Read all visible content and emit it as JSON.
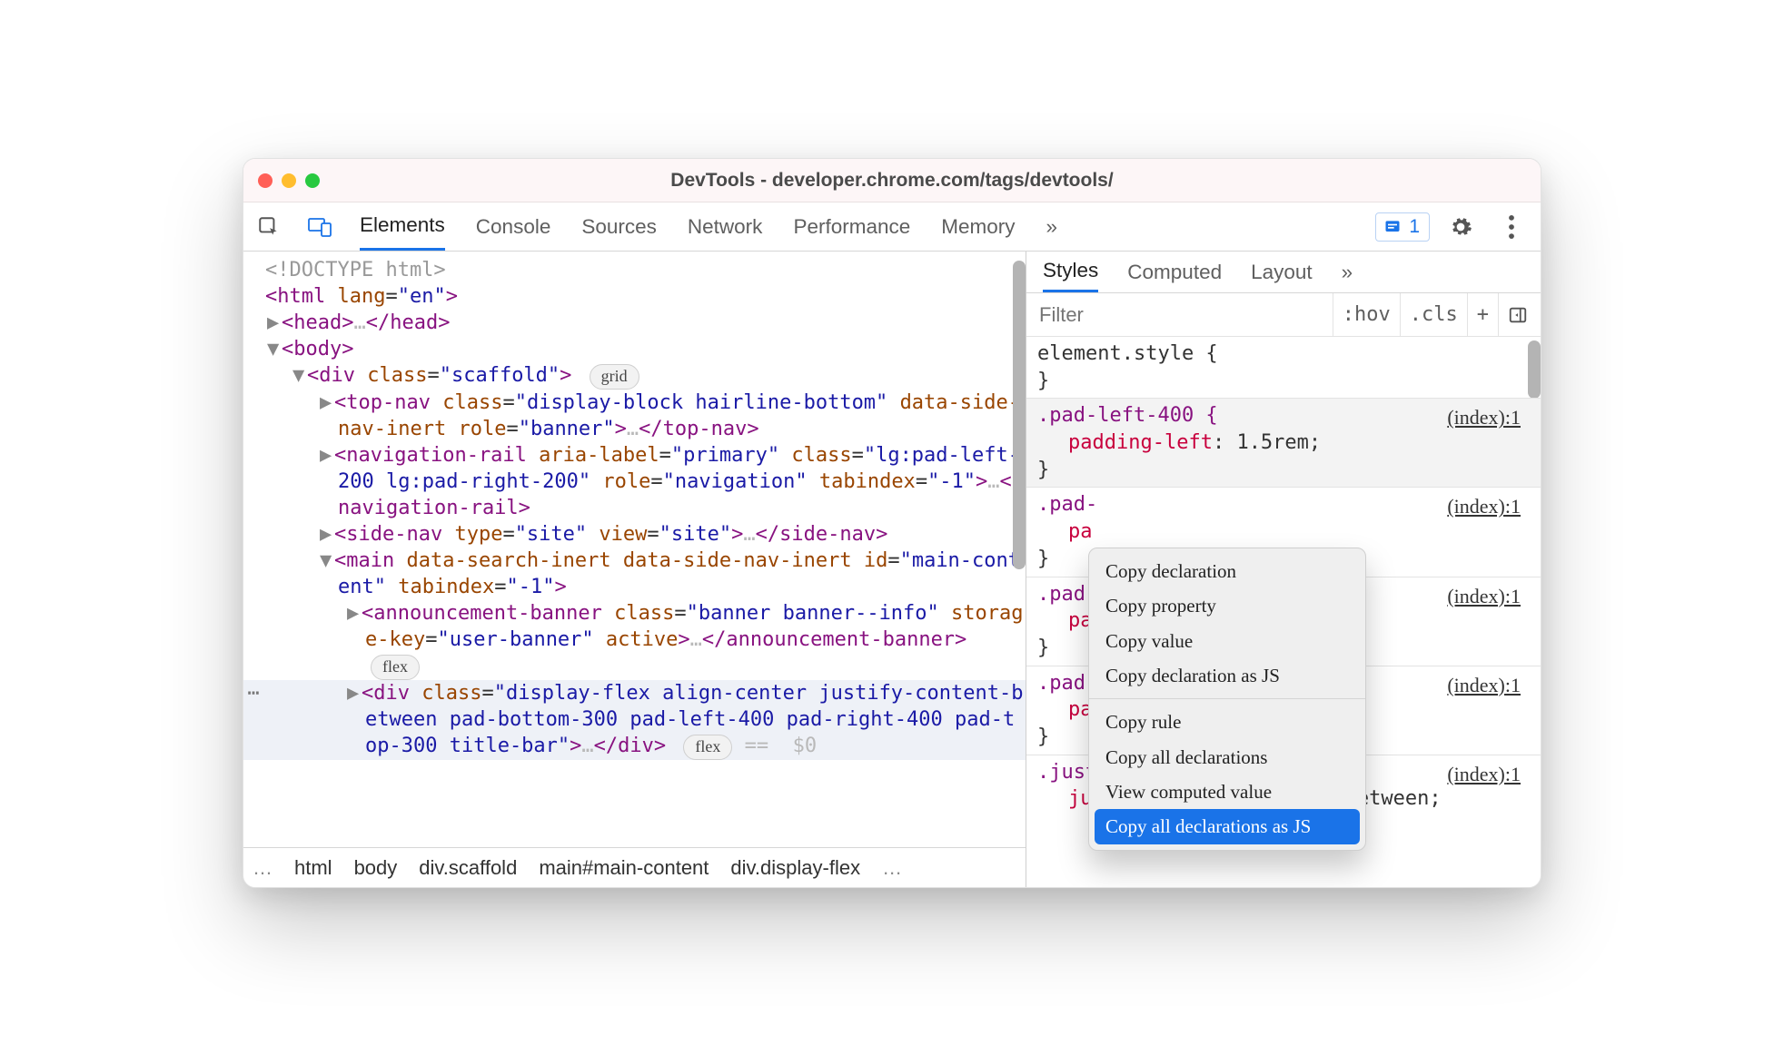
{
  "window": {
    "title": "DevTools - developer.chrome.com/tags/devtools/"
  },
  "toolbar": {
    "tabs": [
      "Elements",
      "Console",
      "Sources",
      "Network",
      "Performance",
      "Memory"
    ],
    "overflow": "»",
    "issues_count": "1"
  },
  "dom": {
    "l0": "<!DOCTYPE html>",
    "badge_grid": "grid",
    "badge_flex": "flex",
    "eq0": "==  $0"
  },
  "crumbs": {
    "ell": "…",
    "c0": "html",
    "c1": "body",
    "c2": "div.scaffold",
    "c3": "main#main-content",
    "c4": "div.display-flex",
    "ell2": "…"
  },
  "subtabs": {
    "t0": "Styles",
    "t1": "Computed",
    "t2": "Layout",
    "more": "»"
  },
  "filter": {
    "ph": "Filter",
    "hov": ":hov",
    "cls": ".cls",
    "plus": "+"
  },
  "styles": {
    "block0": {
      "sel": "element.style {",
      "close": "}"
    },
    "block1": {
      "sel": ".pad-left-400 {",
      "src": "(index):1",
      "decl_p": "padding-left",
      "decl_v": ": 1.5rem;",
      "close": "}"
    },
    "block2": {
      "sel": ".pad-",
      "src": "(index):1",
      "decl_p": "pa",
      "close": "}"
    },
    "block3": {
      "sel": ".pad-",
      "src": "(index):1",
      "decl_p": "pa",
      "close": "}"
    },
    "block4": {
      "sel": ".pad-",
      "src": "(index):1",
      "decl_p": "pa",
      "close": "}"
    },
    "block5": {
      "sel": ".justify-content-between {",
      "src": "(index):1",
      "decl_p": "justify-content",
      "decl_v": ": space-between;"
    }
  },
  "menu": {
    "m0": "Copy declaration",
    "m1": "Copy property",
    "m2": "Copy value",
    "m3": "Copy declaration as JS",
    "m4": "Copy rule",
    "m5": "Copy all declarations",
    "m6": "View computed value",
    "m7": "Copy all declarations as JS"
  }
}
